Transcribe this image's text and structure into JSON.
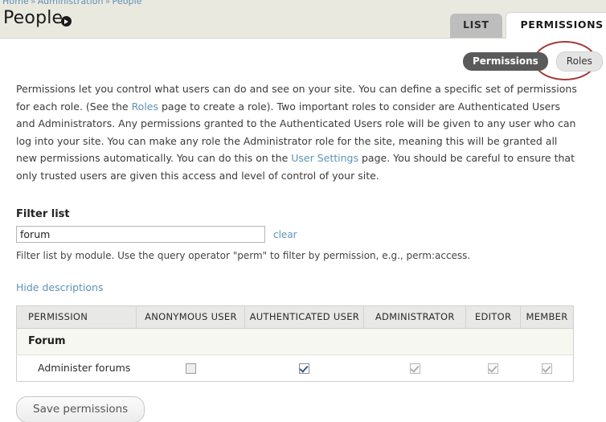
{
  "breadcrumb": {
    "items": [
      "Home",
      "Administration",
      "People"
    ],
    "separator": "»"
  },
  "header": {
    "title": "People",
    "contextual_icon": "contextual-links-icon"
  },
  "primary_tabs": [
    {
      "label": "LIST",
      "active": false
    },
    {
      "label": "PERMISSIONS",
      "active": true
    }
  ],
  "secondary_tabs": [
    {
      "label": "Permissions",
      "active": true
    },
    {
      "label": "Roles",
      "active": false
    }
  ],
  "annotation": {
    "shape": "ellipse",
    "color": "#a33b3b",
    "targets": "Roles"
  },
  "intro": {
    "part1": "Permissions let you control what users can do and see on your site. You can define a specific set of permissions for each role. (See the ",
    "link_roles": "Roles",
    "part2": " page to create a role). Two important roles to consider are Authenticated Users and Administrators. Any permissions granted to the Authenticated Users role will be given to any user who can log into your site. You can make any role the Administrator role for the site, meaning this will be granted all new permissions automatically. You can do this on the ",
    "link_user_settings": "User Settings",
    "part3": " page. You should be careful to ensure that only trusted users are given this access and level of control of your site."
  },
  "filter": {
    "label": "Filter list",
    "value": "forum",
    "placeholder": "",
    "clear_label": "clear",
    "help": "Filter list by module. Use the query operator \"perm\" to filter by permission, e.g., perm:access."
  },
  "descriptions_toggle": {
    "label": "Hide descriptions"
  },
  "table": {
    "columns": [
      "PERMISSION",
      "ANONYMOUS USER",
      "AUTHENTICATED USER",
      "ADMINISTRATOR",
      "EDITOR",
      "MEMBER"
    ],
    "groups": [
      {
        "name": "Forum",
        "rows": [
          {
            "permission": "Administer forums",
            "checkboxes": [
              {
                "role": "ANONYMOUS USER",
                "checked": false,
                "disabled": false
              },
              {
                "role": "AUTHENTICATED USER",
                "checked": true,
                "disabled": false
              },
              {
                "role": "ADMINISTRATOR",
                "checked": true,
                "disabled": true
              },
              {
                "role": "EDITOR",
                "checked": true,
                "disabled": true
              },
              {
                "role": "MEMBER",
                "checked": true,
                "disabled": true
              }
            ]
          }
        ]
      }
    ]
  },
  "actions": {
    "save_label": "Save permissions"
  },
  "colors": {
    "header_band": "#e9e9e0",
    "tab_inactive": "#bdbdbd",
    "tab_active": "#ffffff",
    "stab_active_bg": "#5a5a5a",
    "link": "#5d93b5",
    "annotation": "#a33b3b",
    "table_header_bg": "#e8e8e6",
    "group_row_bg": "#f7f7f2"
  }
}
